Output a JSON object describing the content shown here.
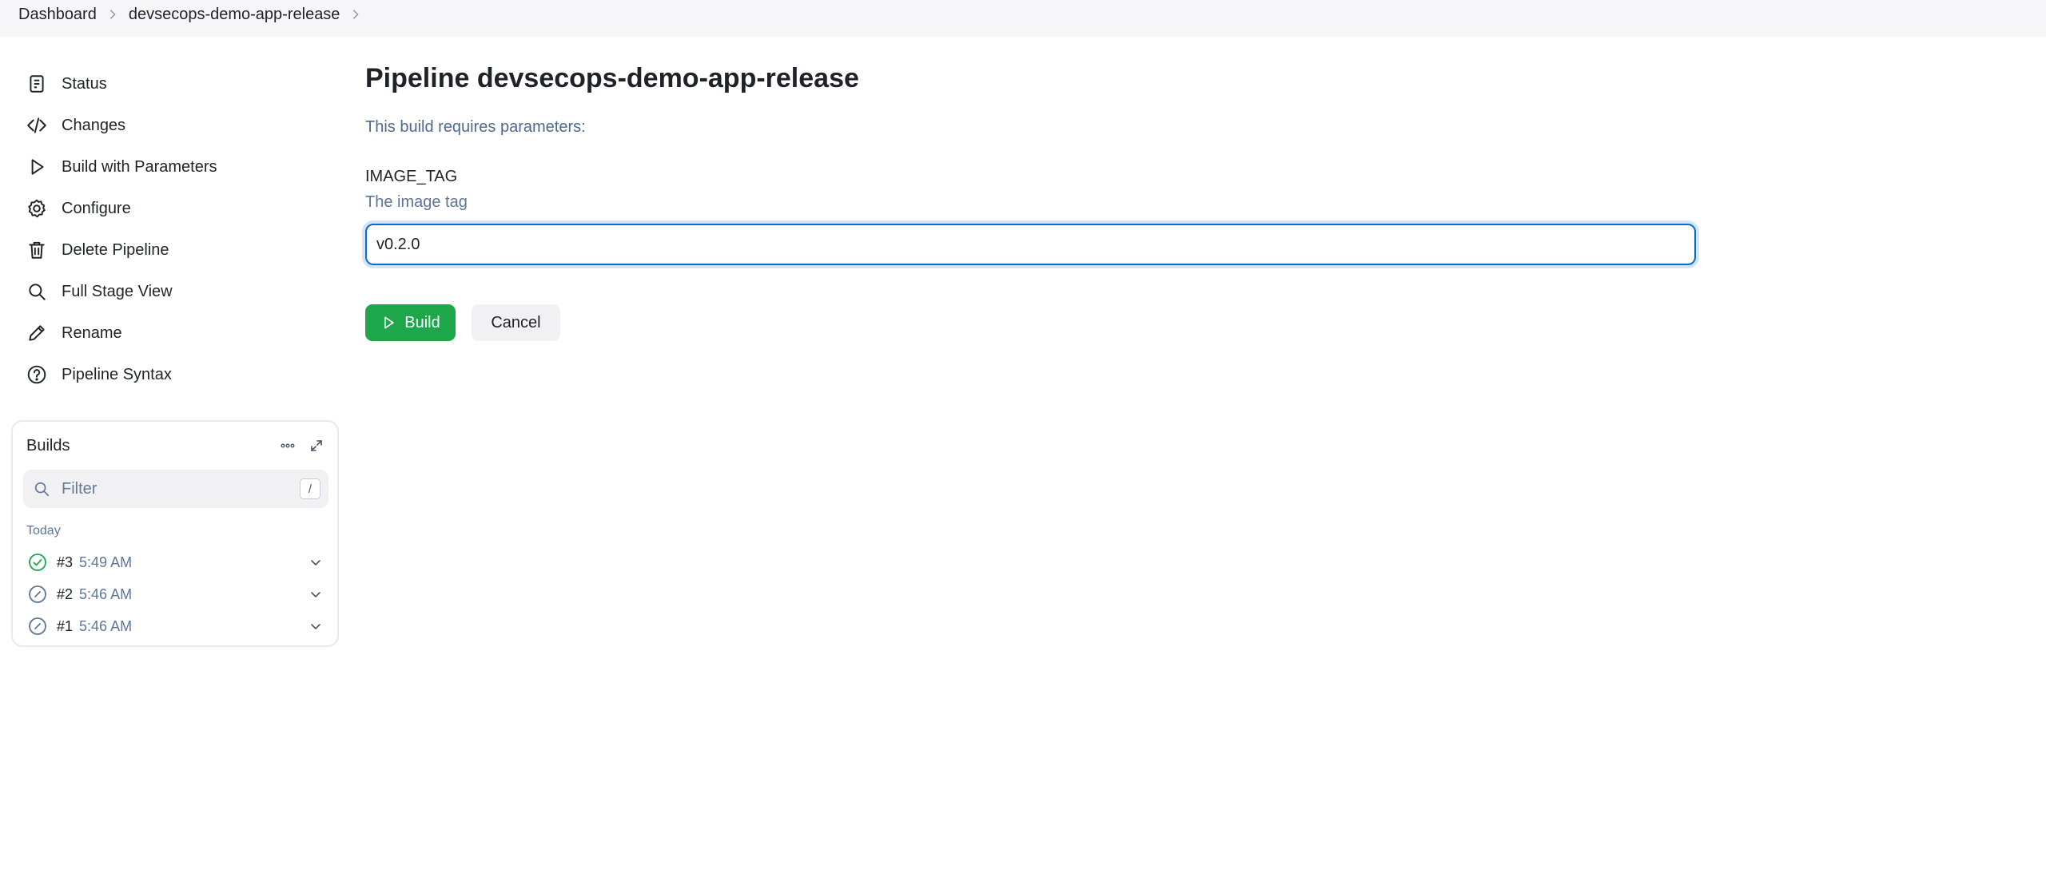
{
  "breadcrumb": {
    "items": [
      "Dashboard",
      "devsecops-demo-app-release"
    ]
  },
  "sidebar": {
    "tasks": [
      {
        "label": "Status",
        "icon": "document-icon"
      },
      {
        "label": "Changes",
        "icon": "code-icon"
      },
      {
        "label": "Build with Parameters",
        "icon": "play-icon"
      },
      {
        "label": "Configure",
        "icon": "gear-icon"
      },
      {
        "label": "Delete Pipeline",
        "icon": "trash-icon"
      },
      {
        "label": "Full Stage View",
        "icon": "search-icon"
      },
      {
        "label": "Rename",
        "icon": "pencil-icon"
      },
      {
        "label": "Pipeline Syntax",
        "icon": "help-icon"
      }
    ]
  },
  "builds": {
    "title": "Builds",
    "filter_placeholder": "Filter",
    "filter_shortcut": "/",
    "section": "Today",
    "items": [
      {
        "number": "#3",
        "time": "5:49 AM",
        "status": "success"
      },
      {
        "number": "#2",
        "time": "5:46 AM",
        "status": "aborted"
      },
      {
        "number": "#1",
        "time": "5:46 AM",
        "status": "aborted"
      }
    ]
  },
  "main": {
    "title": "Pipeline devsecops-demo-app-release",
    "description": "This build requires parameters:",
    "parameter": {
      "name": "IMAGE_TAG",
      "help": "The image tag",
      "value": "v0.2.0"
    },
    "build_label": "Build",
    "cancel_label": "Cancel"
  },
  "colors": {
    "accent": "#0b6bcb",
    "success": "#1ea64b",
    "muted_text": "#5d7699"
  }
}
